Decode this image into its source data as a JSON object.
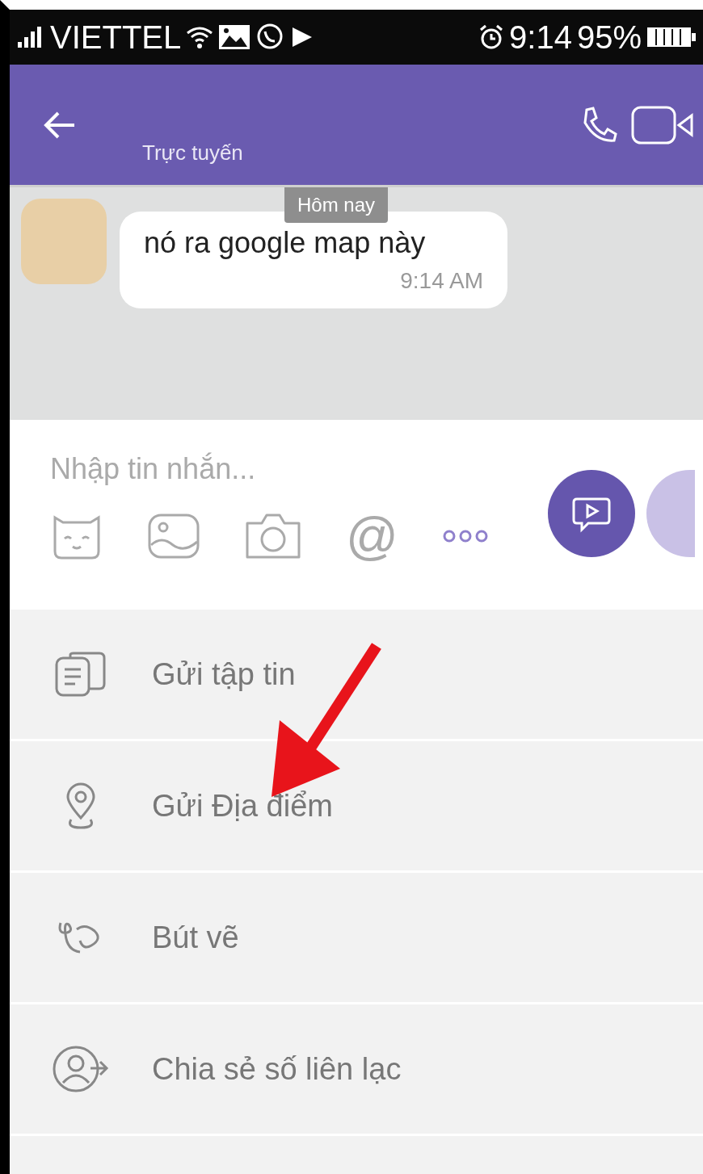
{
  "status_bar": {
    "carrier": "VIETTEL",
    "time": "9:14",
    "battery": "95%"
  },
  "header": {
    "subtitle": "Trực tuyến"
  },
  "chat": {
    "date_label": "Hôm nay",
    "messages": [
      {
        "text": "nó ra google map này",
        "time": "9:14 AM"
      }
    ]
  },
  "composer": {
    "placeholder": "Nhập tin nhắn...",
    "mention_icon": "@"
  },
  "menu": [
    {
      "kind": "file",
      "label": "Gửi tập tin"
    },
    {
      "kind": "location",
      "label": "Gửi Địa điểm"
    },
    {
      "kind": "doodle",
      "label": "Bút vẽ"
    },
    {
      "kind": "contact",
      "label": "Chia sẻ số liên lạc"
    }
  ],
  "annotation": {
    "kind": "arrow"
  }
}
